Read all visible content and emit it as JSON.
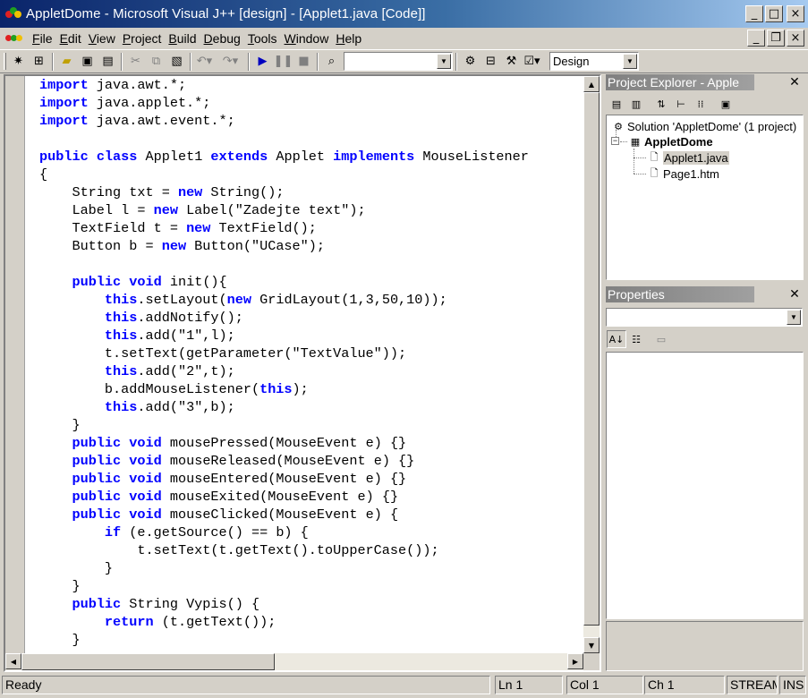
{
  "window": {
    "title": "AppletDome - Microsoft Visual J++ [design] - [Applet1.java [Code]]",
    "minimize": "_",
    "maximize": "□",
    "close": "×",
    "restore": "❐"
  },
  "menu": {
    "items": [
      {
        "ul": "F",
        "rest": "ile"
      },
      {
        "ul": "E",
        "rest": "dit"
      },
      {
        "ul": "V",
        "rest": "iew"
      },
      {
        "ul": "P",
        "rest": "roject"
      },
      {
        "ul": "B",
        "rest": "uild"
      },
      {
        "ul": "D",
        "rest": "ebug"
      },
      {
        "ul": "T",
        "rest": "ools"
      },
      {
        "ul": "W",
        "rest": "indow"
      },
      {
        "ul": "H",
        "rest": "elp"
      }
    ]
  },
  "toolbar": {
    "find_value": "",
    "config_value": "Design"
  },
  "colors": {
    "keyword": "#0000ff",
    "title_start": "#0a246a",
    "title_end": "#a6caf0"
  },
  "editor": {
    "lines": [
      [
        {
          "t": "import",
          "k": 1
        },
        {
          "t": " java.awt.*;"
        }
      ],
      [
        {
          "t": "import",
          "k": 1
        },
        {
          "t": " java.applet.*;"
        }
      ],
      [
        {
          "t": "import",
          "k": 1
        },
        {
          "t": " java.awt.event.*;"
        }
      ],
      [
        {
          "t": ""
        }
      ],
      [
        {
          "t": "public",
          "k": 1
        },
        {
          "t": " "
        },
        {
          "t": "class",
          "k": 1
        },
        {
          "t": " Applet1 "
        },
        {
          "t": "extends",
          "k": 1
        },
        {
          "t": " Applet "
        },
        {
          "t": "implements",
          "k": 1
        },
        {
          "t": " MouseListener"
        }
      ],
      [
        {
          "t": "{"
        }
      ],
      [
        {
          "t": "    String txt = "
        },
        {
          "t": "new",
          "k": 1
        },
        {
          "t": " String();"
        }
      ],
      [
        {
          "t": "    Label l = "
        },
        {
          "t": "new",
          "k": 1
        },
        {
          "t": " Label(\"Zadejte text\");"
        }
      ],
      [
        {
          "t": "    TextField t = "
        },
        {
          "t": "new",
          "k": 1
        },
        {
          "t": " TextField();"
        }
      ],
      [
        {
          "t": "    Button b = "
        },
        {
          "t": "new",
          "k": 1
        },
        {
          "t": " Button(\"UCase\");"
        }
      ],
      [
        {
          "t": ""
        }
      ],
      [
        {
          "t": "    "
        },
        {
          "t": "public",
          "k": 1
        },
        {
          "t": " "
        },
        {
          "t": "void",
          "k": 1
        },
        {
          "t": " init(){"
        }
      ],
      [
        {
          "t": "        "
        },
        {
          "t": "this",
          "k": 1
        },
        {
          "t": ".setLayout("
        },
        {
          "t": "new",
          "k": 1
        },
        {
          "t": " GridLayout(1,3,50,10));"
        }
      ],
      [
        {
          "t": "        "
        },
        {
          "t": "this",
          "k": 1
        },
        {
          "t": ".addNotify();"
        }
      ],
      [
        {
          "t": "        "
        },
        {
          "t": "this",
          "k": 1
        },
        {
          "t": ".add(\"1\",l);"
        }
      ],
      [
        {
          "t": "        t.setText(getParameter(\"TextValue\"));"
        }
      ],
      [
        {
          "t": "        "
        },
        {
          "t": "this",
          "k": 1
        },
        {
          "t": ".add(\"2\",t);"
        }
      ],
      [
        {
          "t": "        b.addMouseListener("
        },
        {
          "t": "this",
          "k": 1
        },
        {
          "t": ");"
        }
      ],
      [
        {
          "t": "        "
        },
        {
          "t": "this",
          "k": 1
        },
        {
          "t": ".add(\"3\",b);"
        }
      ],
      [
        {
          "t": "    }"
        }
      ],
      [
        {
          "t": "    "
        },
        {
          "t": "public",
          "k": 1
        },
        {
          "t": " "
        },
        {
          "t": "void",
          "k": 1
        },
        {
          "t": " mousePressed(MouseEvent e) {}"
        }
      ],
      [
        {
          "t": "    "
        },
        {
          "t": "public",
          "k": 1
        },
        {
          "t": " "
        },
        {
          "t": "void",
          "k": 1
        },
        {
          "t": " mouseReleased(MouseEvent e) {}"
        }
      ],
      [
        {
          "t": "    "
        },
        {
          "t": "public",
          "k": 1
        },
        {
          "t": " "
        },
        {
          "t": "void",
          "k": 1
        },
        {
          "t": " mouseEntered(MouseEvent e) {}"
        }
      ],
      [
        {
          "t": "    "
        },
        {
          "t": "public",
          "k": 1
        },
        {
          "t": " "
        },
        {
          "t": "void",
          "k": 1
        },
        {
          "t": " mouseExited(MouseEvent e) {}"
        }
      ],
      [
        {
          "t": "    "
        },
        {
          "t": "public",
          "k": 1
        },
        {
          "t": " "
        },
        {
          "t": "void",
          "k": 1
        },
        {
          "t": " mouseClicked(MouseEvent e) {"
        }
      ],
      [
        {
          "t": "        "
        },
        {
          "t": "if",
          "k": 1
        },
        {
          "t": " (e.getSource() == b) {"
        }
      ],
      [
        {
          "t": "            t.setText(t.getText().toUpperCase());"
        }
      ],
      [
        {
          "t": "        }"
        }
      ],
      [
        {
          "t": "    }"
        }
      ],
      [
        {
          "t": "    "
        },
        {
          "t": "public",
          "k": 1
        },
        {
          "t": " String Vypis() {"
        }
      ],
      [
        {
          "t": "        "
        },
        {
          "t": "return",
          "k": 1
        },
        {
          "t": " (t.getText());"
        }
      ],
      [
        {
          "t": "    }"
        }
      ]
    ]
  },
  "project_explorer": {
    "title": "Project Explorer - Apple",
    "solution": "Solution 'AppletDome' (1 project)",
    "project": "AppletDome",
    "files": [
      "Applet1.java",
      "Page1.htm"
    ],
    "expander": "−"
  },
  "properties": {
    "title": "Properties",
    "object_value": ""
  },
  "status": {
    "message": "Ready",
    "line": "Ln 1",
    "col": "Col 1",
    "ch": "Ch 1",
    "mode1": "STREAM",
    "mode2": "INS"
  }
}
